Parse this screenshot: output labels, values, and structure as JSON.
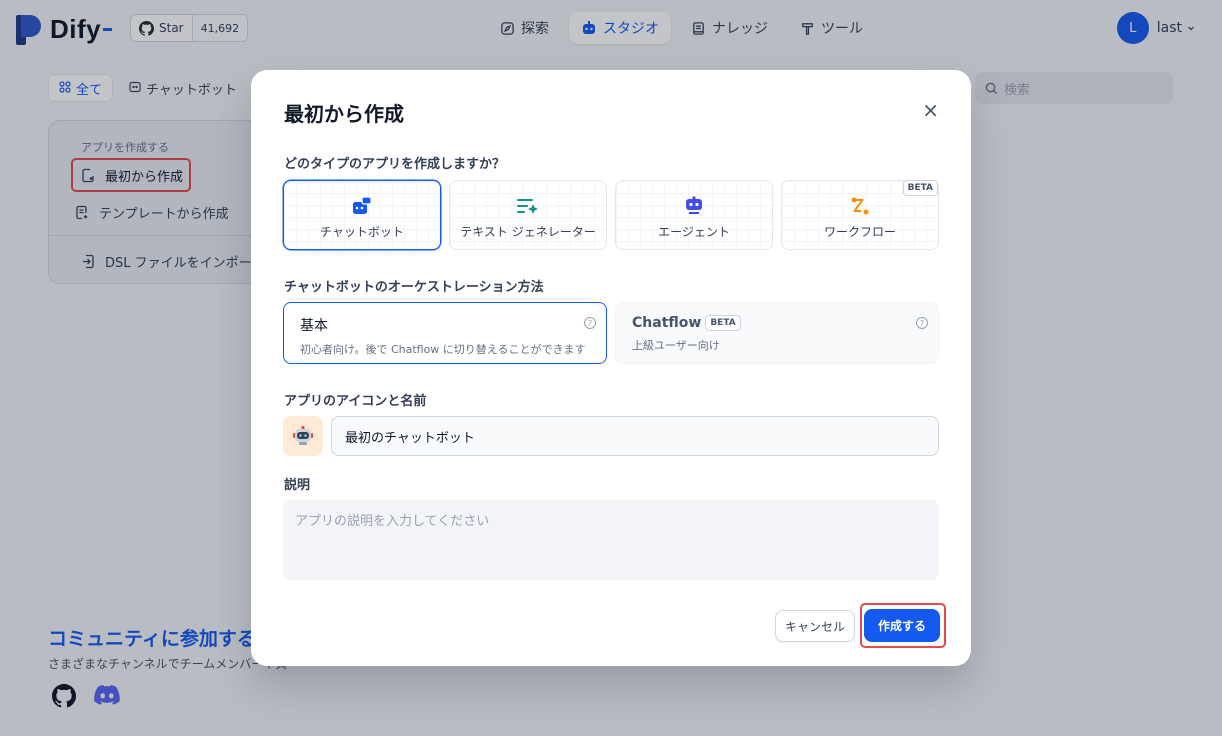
{
  "header": {
    "logo_text": "Dify",
    "github_star_label": "Star",
    "github_star_count": "41,692",
    "nav": [
      {
        "label": "探索",
        "icon": "compass-icon"
      },
      {
        "label": "スタジオ",
        "icon": "robot-icon",
        "active": true
      },
      {
        "label": "ナレッジ",
        "icon": "book-icon"
      },
      {
        "label": "ツール",
        "icon": "hammer-icon"
      }
    ],
    "user_initial": "L",
    "user_name": "last"
  },
  "background": {
    "filters": [
      {
        "label": "全て",
        "active": true
      },
      {
        "label": "チャットボット"
      }
    ],
    "search_placeholder": "検索",
    "create_card": {
      "title": "アプリを作成する",
      "items": [
        "最初から作成",
        "テンプレートから作成",
        "DSL ファイルをインポート"
      ]
    },
    "community": {
      "title": "コミュニティに参加する",
      "subtitle": "さまざまなチャンネルでチームメンバーや貢"
    }
  },
  "modal": {
    "title": "最初から作成",
    "close_label": "×",
    "type_question": "どのタイプのアプリを作成しますか？",
    "app_types": [
      {
        "label": "チャットボット",
        "icon": "chatbot-icon",
        "selected": true
      },
      {
        "label": "テキスト ジェネレーター",
        "icon": "text-generator-icon"
      },
      {
        "label": "エージェント",
        "icon": "agent-icon"
      },
      {
        "label": "ワークフロー",
        "icon": "workflow-icon",
        "badge": "BETA"
      }
    ],
    "orchestration_label": "チャットボットのオーケストレーション方法",
    "orchestration": [
      {
        "title": "基本",
        "desc": "初心者向け。後で Chatflow に切り替えることができます",
        "selected": true
      },
      {
        "title": "Chatflow",
        "badge": "BETA",
        "desc": "上級ユーザー向け"
      }
    ],
    "help_mark": "?",
    "icon_name_label": "アプリのアイコンと名前",
    "app_name_value": "最初のチャットボット",
    "description_label": "説明",
    "description_placeholder": "アプリの説明を入力してください",
    "cancel_label": "キャンセル",
    "create_label": "作成する"
  },
  "colors": {
    "accent": "#155aef",
    "highlight": "#e5484d",
    "workflow": "#f79009",
    "text_gen": "#0e9384",
    "agent": "#444ce7"
  }
}
